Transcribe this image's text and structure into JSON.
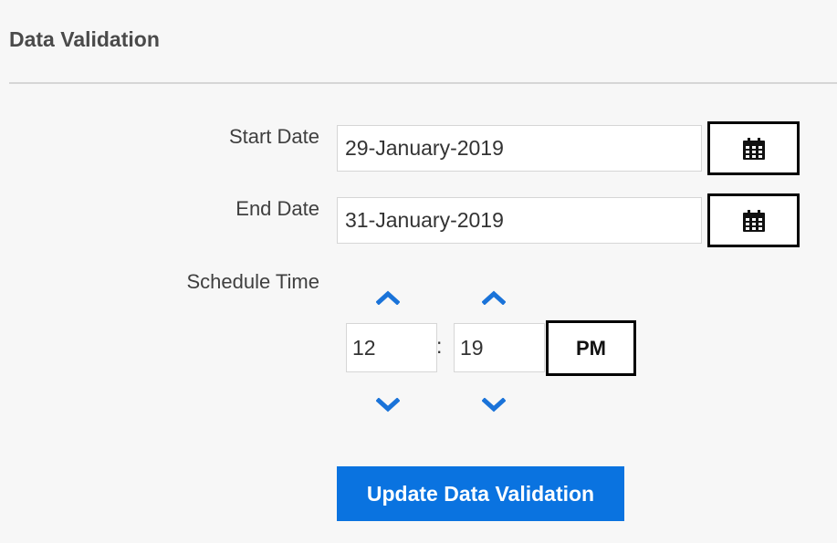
{
  "header": {
    "title": "Data Validation"
  },
  "form": {
    "start_date": {
      "label": "Start Date",
      "value": "29-January-2019"
    },
    "end_date": {
      "label": "End Date",
      "value": "31-January-2019"
    },
    "schedule_time": {
      "label": "Schedule Time",
      "hour": "12",
      "minute": "19",
      "separator": ":",
      "meridian": "PM"
    },
    "submit_label": "Update Data Validation"
  },
  "icons": {
    "calendar": "calendar-icon",
    "increment": "chevron-up-icon",
    "decrement": "chevron-down-icon"
  },
  "colors": {
    "accent": "#0a73e0",
    "chevron": "#1a73d9",
    "background": "#f7f7f7"
  }
}
